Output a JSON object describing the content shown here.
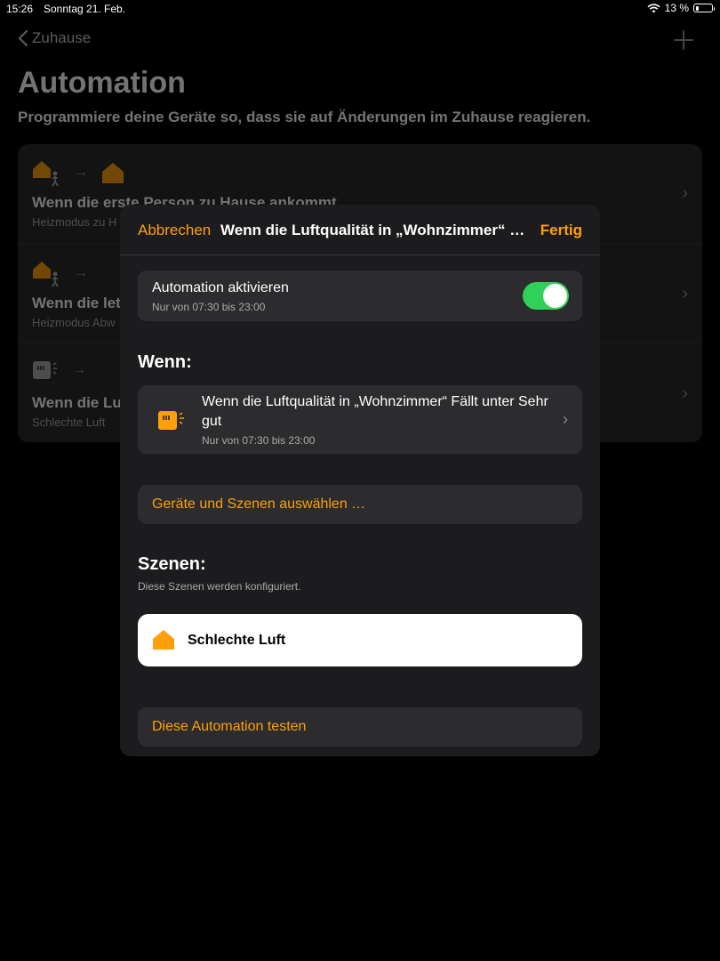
{
  "status_bar": {
    "time": "15:26",
    "date": "Sonntag 21. Feb.",
    "battery": "13 %",
    "battery_level": 0.13
  },
  "nav": {
    "back_label": "Zuhause",
    "add_icon": "plus-icon"
  },
  "page": {
    "title": "Automation",
    "subtitle": "Programmiere deine Geräte so, dass sie auf Änderungen im Zuhause reagieren."
  },
  "automations": [
    {
      "title": "Wenn die erste Person zu Hause ankommt",
      "subtitle": "Heizmodus zu H"
    },
    {
      "title": "Wenn die let",
      "subtitle": "Heizmodus Abw"
    },
    {
      "title": "Wenn die Luf",
      "subtitle": "Schlechte Luft"
    }
  ],
  "modal": {
    "cancel": "Abbrechen",
    "title": "Wenn die Luftqualität in „Wohnzimmer“ Fä...",
    "done": "Fertig",
    "enable": {
      "label": "Automation aktivieren",
      "sub": "Nur von 07:30 bis 23:00",
      "on": true
    },
    "when_heading": "Wenn:",
    "trigger": {
      "text": "Wenn die Luftqualität in „Wohnzimmer“ Fällt unter Sehr gut",
      "sub": "Nur von 07:30 bis 23:00"
    },
    "select_devices": "Geräte und Szenen auswählen …",
    "scenes_heading": "Szenen:",
    "scenes_sub": "Diese Szenen werden konfiguriert.",
    "scene": "Schlechte Luft",
    "test": "Diese Automation testen"
  },
  "colors": {
    "accent": "#ff9f0a",
    "toggle_on": "#30d158",
    "modal_bg": "#1c1c1e",
    "cell_bg": "#2c2c2e"
  }
}
